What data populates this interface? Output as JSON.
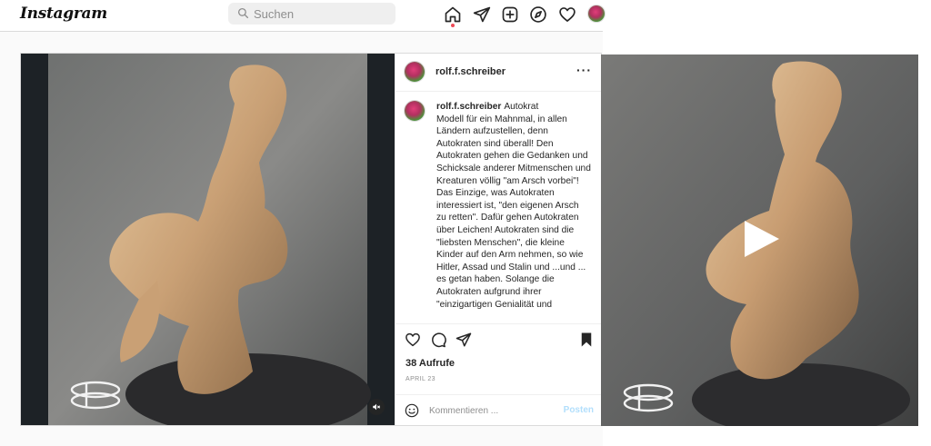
{
  "header": {
    "logo": "Instagram",
    "search_placeholder": "Suchen",
    "nav_icons": [
      "home-icon",
      "direct-icon",
      "new-post-icon",
      "explore-icon",
      "activity-icon",
      "profile-avatar"
    ]
  },
  "post": {
    "username": "rolf.f.schreiber",
    "more_label": "···",
    "caption_title": "Autokrat",
    "caption_body": "Modell für ein Mahnmal, in allen Ländern aufzustellen, denn Autokraten sind überall! Den Autokraten gehen die Gedanken und Schicksale anderer Mitmenschen und Kreaturen völlig \"am Arsch vorbei\"! Das Einzige, was Autokraten interessiert ist, \"den eigenen Arsch zu retten\". Dafür gehen Autokraten über Leichen! Autokraten sind die \"liebsten Menschen\", die kleine Kinder auf den Arm nehmen, so wie Hitler, Assad und Stalin und ...und ... es getan haben. Solange die Autokraten aufgrund ihrer \"einzigartigen Genialität und",
    "views": "38 Aufrufe",
    "date": "APRIL 23",
    "comment_placeholder": "Kommentieren ...",
    "post_button": "Posten",
    "action_icons": [
      "like-icon",
      "comment-icon",
      "share-icon",
      "save-icon"
    ]
  },
  "colors": {
    "border": "#dbdbdb",
    "link_disabled": "#b2dffc",
    "notification": "#ed4956"
  }
}
